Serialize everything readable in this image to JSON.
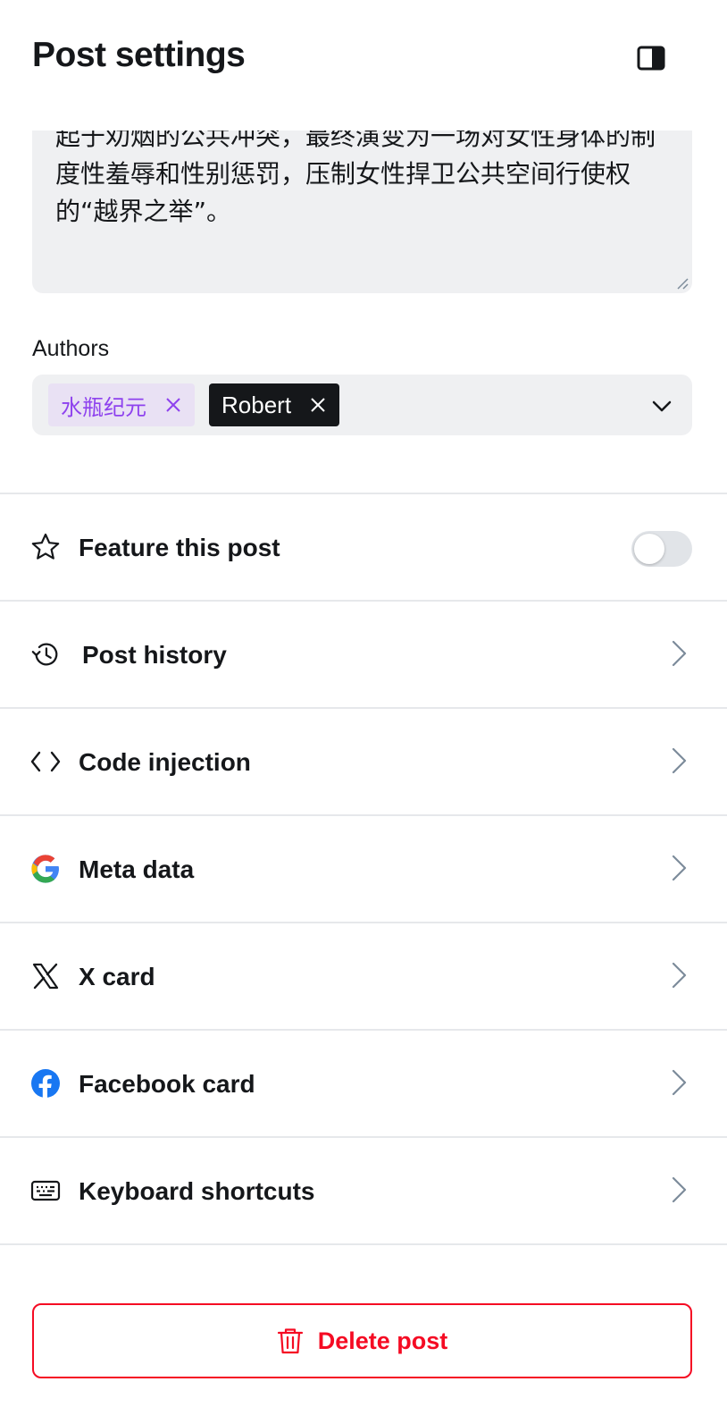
{
  "header": {
    "title": "Post settings",
    "panel_toggle_icon": "sidebar-panel-icon"
  },
  "excerpt": {
    "value": "起于劝烟的公共冲突，最终演变为一场对女性身体的制度性羞辱和性别惩罚，压制女性捍卫公共空间行使权的“越界之举”。"
  },
  "authors": {
    "label": "Authors",
    "chips": [
      {
        "name": "水瓶纪元",
        "bg": "#e9e1f4",
        "fg": "#8e42ee"
      },
      {
        "name": "Robert",
        "bg": "#15171a",
        "fg": "#ffffff"
      }
    ]
  },
  "menu": {
    "feature": {
      "label": "Feature this post",
      "icon": "star-icon",
      "enabled": false
    },
    "history": {
      "label": "Post history",
      "icon": "history-icon"
    },
    "code": {
      "label": "Code injection",
      "icon": "code-icon"
    },
    "meta": {
      "label": "Meta data",
      "icon": "google-icon"
    },
    "x": {
      "label": "X card",
      "icon": "x-logo-icon"
    },
    "facebook": {
      "label": "Facebook card",
      "icon": "facebook-icon"
    },
    "shortcuts": {
      "label": "Keyboard shortcuts",
      "icon": "keyboard-icon"
    }
  },
  "delete": {
    "label": "Delete post",
    "icon": "trash-icon",
    "color": "#f50b23"
  },
  "colors": {
    "field_bg": "#eff0f2",
    "divider": "#e6e8eb",
    "text": "#15171a"
  }
}
